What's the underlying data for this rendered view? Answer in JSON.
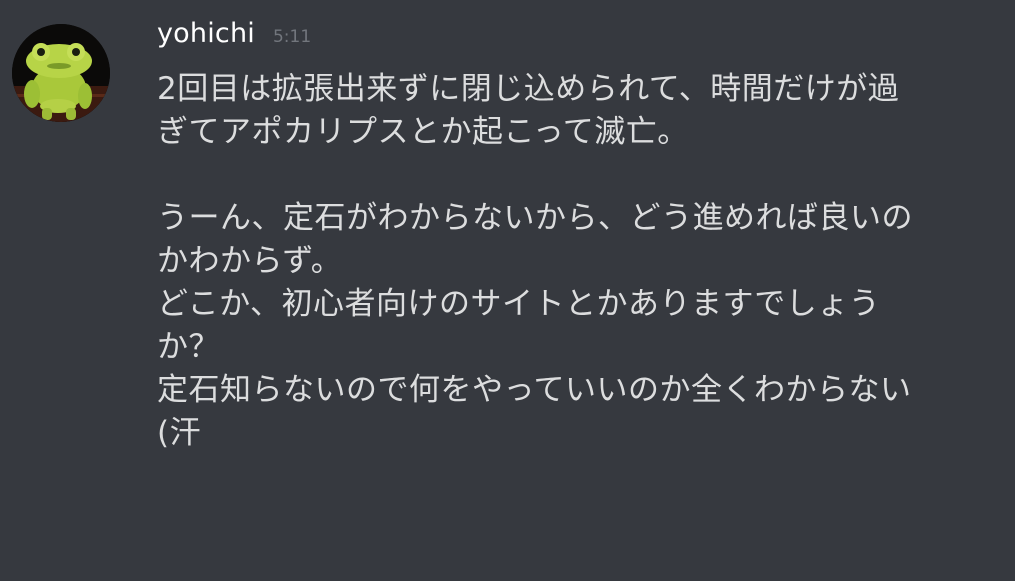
{
  "message": {
    "author": "yohichi",
    "timestamp": "5:11",
    "avatar_icon": "frog-plush-avatar",
    "lines": [
      "2回目は拡張出来ずに閉じ込められて、時間だけが過",
      "ぎてアポカリプスとか起こって滅亡。",
      "",
      "うーん、定石がわからないから、どう進めれば良いの",
      "かわからず。",
      "どこか、初心者向けのサイトとかありますでしょう",
      "か？",
      "定石知らないので何をやっていいのか全くわからない",
      "(汗"
    ]
  },
  "colors": {
    "background": "#36393f",
    "username": "#ffffff",
    "timestamp": "#72767d",
    "text": "#dcddde"
  }
}
